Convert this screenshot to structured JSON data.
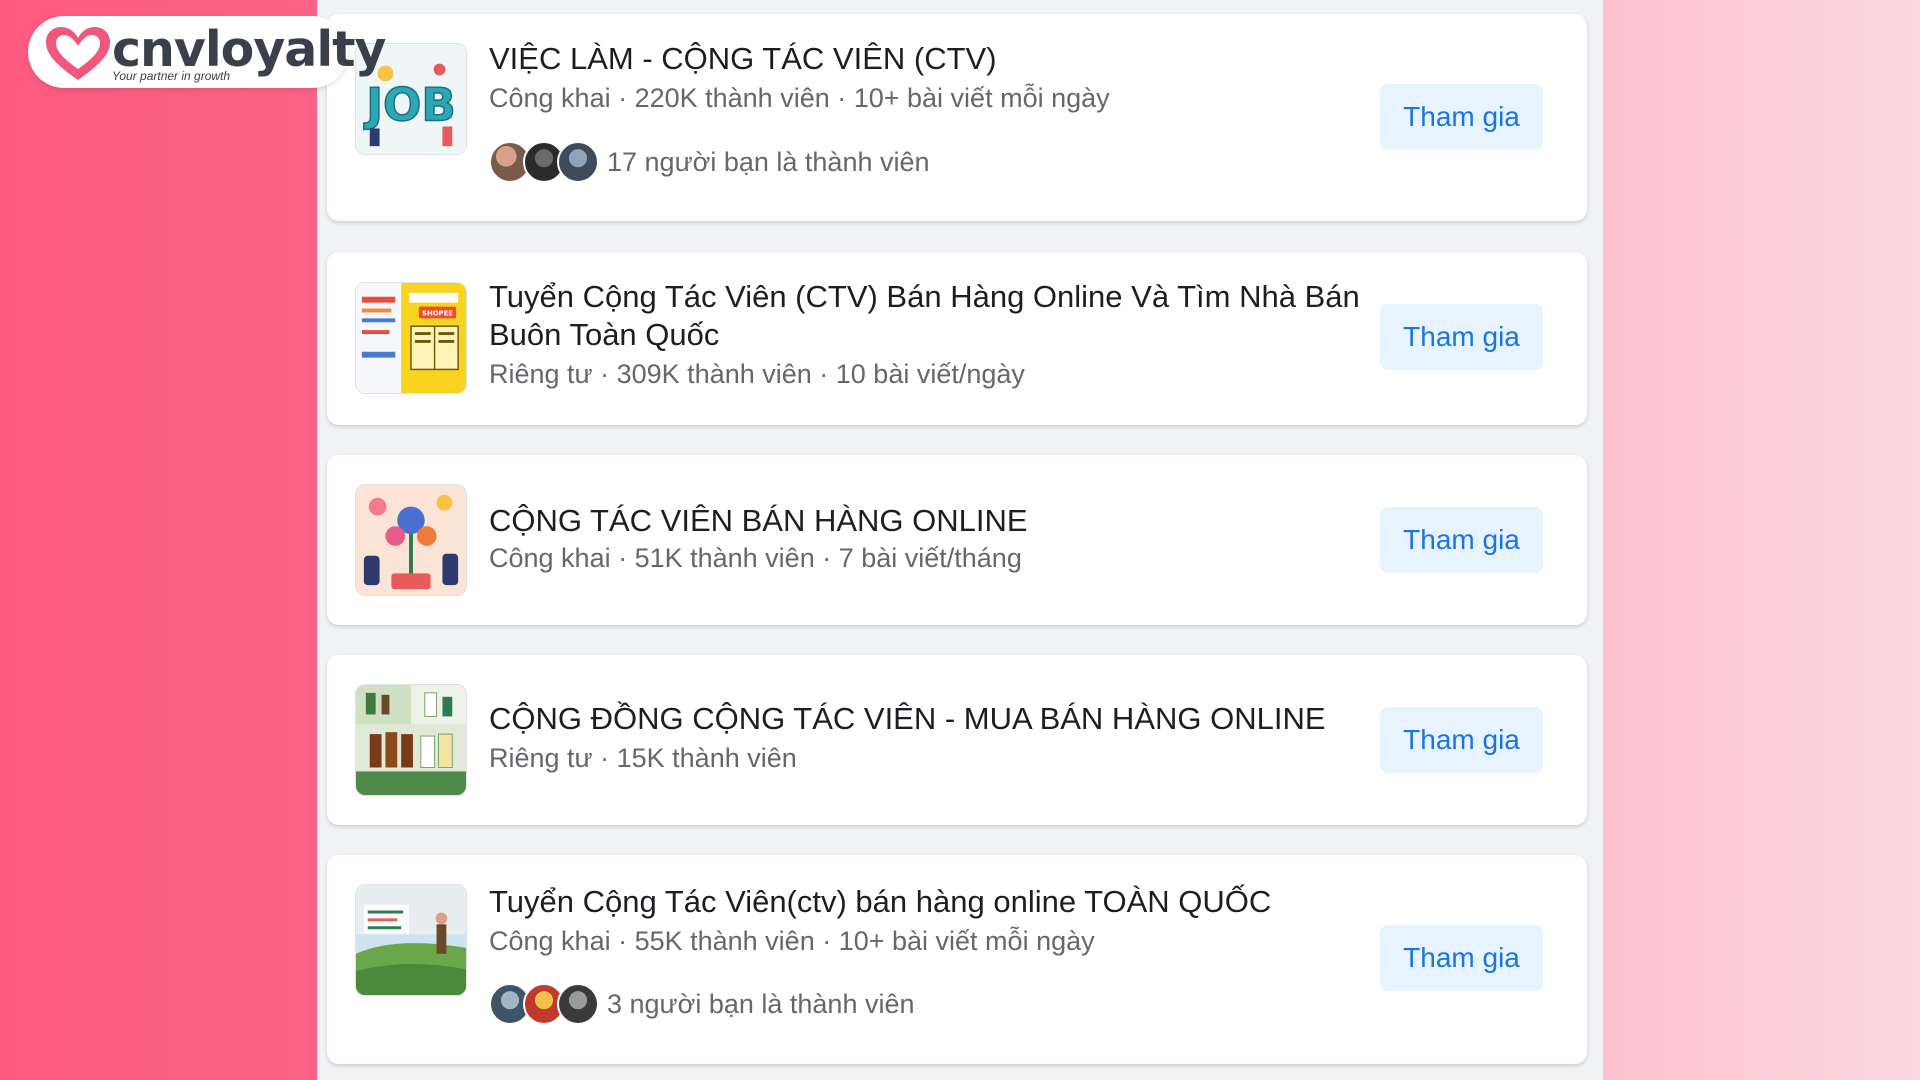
{
  "brand": {
    "name": "cnvloyalty",
    "tagline": "Your partner in growth",
    "color": "#fd5b7e"
  },
  "groups": [
    {
      "title": "VIỆC LÀM - CỘNG TÁC VIÊN (CTV)",
      "meta": "Công khai · 220K thành viên · 10+ bài viết mỗi ngày",
      "friends_text": "17 người bạn là thành viên",
      "join_label": "Tham gia",
      "thumbnail": "job-illustration",
      "thumbnail_text": "JOB"
    },
    {
      "title": "Tuyển Cộng Tác Viên (CTV) Bán Hàng Online Và Tìm Nhà Bán Buôn Toàn Quốc",
      "meta": "Riêng tư · 309K thành viên · 10 bài viết/ngày",
      "join_label": "Tham gia",
      "thumbnail": "shopee-book-image",
      "thumbnail_text": "SHOPEE"
    },
    {
      "title": "CỘNG TÁC VIÊN BÁN HÀNG ONLINE",
      "meta": "Công khai · 51K thành viên · 7 bài viết/tháng",
      "join_label": "Tham gia",
      "thumbnail": "growing-plant-illustration"
    },
    {
      "title": "CỘNG ĐỒNG CỘNG TÁC VIÊN - MUA BÁN HÀNG ONLINE",
      "meta": "Riêng tư · 15K thành viên",
      "join_label": "Tham gia",
      "thumbnail": "product-bottles-photo"
    },
    {
      "title": "Tuyển Cộng Tác Viên(ctv) bán hàng online TOÀN QUỐC",
      "meta": "Công khai · 55K thành viên · 10+ bài viết mỗi ngày",
      "friends_text": "3 người bạn là thành viên",
      "join_label": "Tham gia",
      "thumbnail": "hill-landscape-photo"
    }
  ],
  "colors": {
    "join_button_bg": "#e7f3ff",
    "join_button_text": "#1b74e4",
    "title_text": "#1c1e21",
    "meta_text": "#65676b"
  }
}
